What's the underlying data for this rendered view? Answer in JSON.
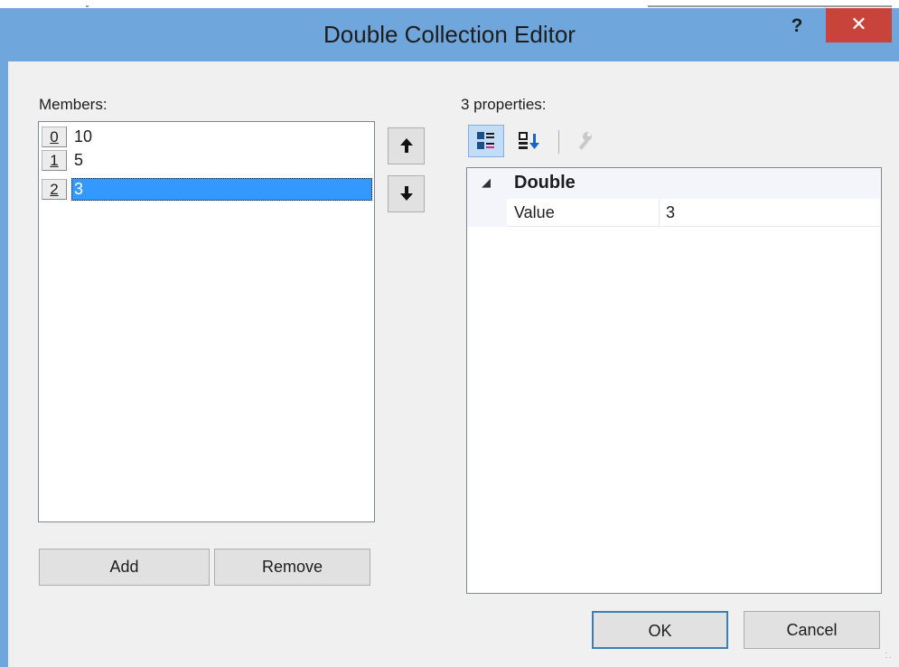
{
  "window": {
    "title": "Double Collection Editor",
    "help_glyph": "?",
    "close_glyph": "✕"
  },
  "members": {
    "label": "Members:",
    "items": [
      {
        "index": "0",
        "value": "10",
        "selected": false
      },
      {
        "index": "1",
        "value": "5",
        "selected": false
      },
      {
        "index": "2",
        "value": "3",
        "selected": true
      }
    ],
    "move_up_glyph": "🡅",
    "move_down_glyph": "🡇",
    "add_label": "Add",
    "remove_label": "Remove"
  },
  "properties": {
    "label": "3 properties:",
    "toolbar": {
      "categorized_icon": "categorized-icon",
      "alphabetical_icon": "alphabetical-sort-icon",
      "property_pages_icon": "wrench-icon"
    },
    "category": "Double",
    "rows": [
      {
        "name": "Value",
        "value": "3"
      }
    ]
  },
  "footer": {
    "ok_label": "OK",
    "cancel_label": "Cancel"
  },
  "colors": {
    "title_bar": "#6fa6dc",
    "close_button": "#c8443a",
    "selection": "#3399ff",
    "dialog_bg": "#f0f0f0"
  }
}
